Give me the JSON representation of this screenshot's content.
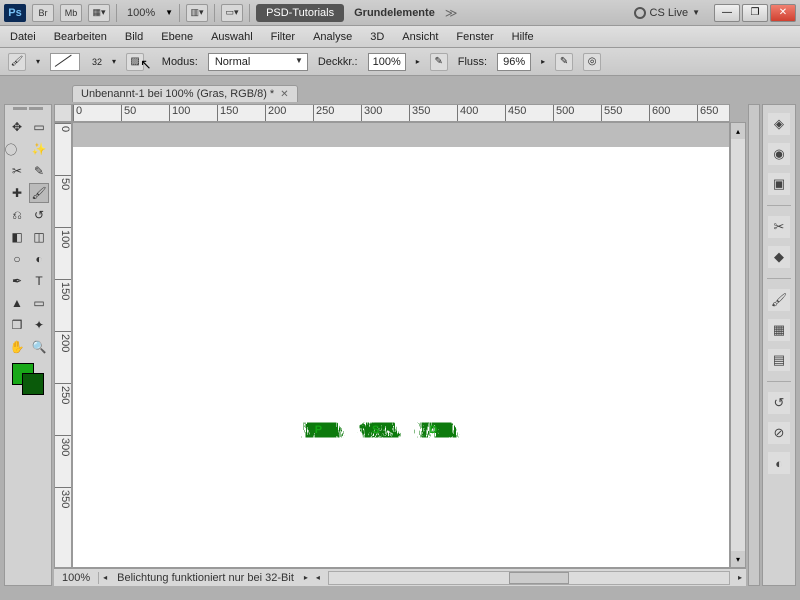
{
  "title": {
    "workspace_btn": "PSD-Tutorials",
    "wsname": "Grundelemente",
    "zoom": "100%",
    "cslive": "CS Live",
    "br": "Br",
    "mb": "Mb"
  },
  "menu": [
    "Datei",
    "Bearbeiten",
    "Bild",
    "Ebene",
    "Auswahl",
    "Filter",
    "Analyse",
    "3D",
    "Ansicht",
    "Fenster",
    "Hilfe"
  ],
  "opts": {
    "brush_size": "32",
    "modus_label": "Modus:",
    "modus_val": "Normal",
    "deck_label": "Deckkr.:",
    "deck_val": "100%",
    "fluss_label": "Fluss:",
    "fluss_val": "96%"
  },
  "doc": {
    "tab": "Unbenannt-1 bei 100% (Gras, RGB/8) *"
  },
  "ruler_h": [
    0,
    50,
    100,
    150,
    200,
    250,
    300,
    350,
    400,
    450,
    500,
    550,
    600,
    650
  ],
  "ruler_v": [
    0,
    50,
    100,
    150,
    200,
    250,
    300,
    350
  ],
  "canvas_text": "PSD",
  "status": {
    "zoom": "100%",
    "msg": "Belichtung funktioniert nur bei 32-Bit"
  },
  "colors": {
    "fg": "#18a818",
    "bg": "#0a5a0a"
  }
}
